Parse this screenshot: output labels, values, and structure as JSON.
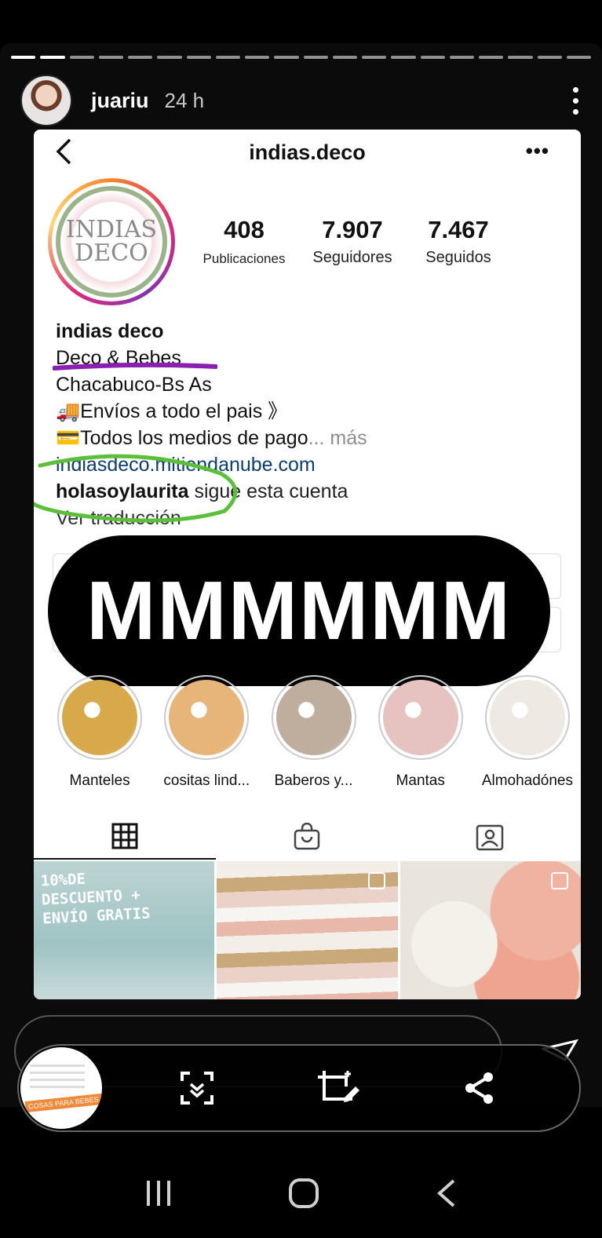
{
  "story": {
    "username": "juariu",
    "time": "24 h",
    "progress_segments": 20,
    "progress_done": 2
  },
  "profile": {
    "username": "indias.deco",
    "logo_text": "INDIAS DECO",
    "stats": [
      {
        "value": "408",
        "label": "Publicaciones"
      },
      {
        "value": "7.907",
        "label": "Seguidores"
      },
      {
        "value": "7.467",
        "label": "Seguidos"
      }
    ],
    "bio": {
      "name": "indias deco",
      "line1": "Deco & Bebes",
      "line2": "Chacabuco-Bs As",
      "line3": "🚚Envíos a todo el pais 》",
      "line4": "💳Todos los medios de pago",
      "more": "... más",
      "link": "indiasdeco.mitiendanube.com",
      "follower": "holasoylaurita",
      "follows_text": " sigue esta cuenta",
      "translate": "Ver traducción"
    },
    "overlay_text": "MMMMMM",
    "highlights": [
      {
        "label": "Manteles",
        "color": "#d7a94a"
      },
      {
        "label": "cositas lind...",
        "color": "#e7b57a"
      },
      {
        "label": "Baberos y...",
        "color": "#bfae9e"
      },
      {
        "label": "Mantas",
        "color": "#e6c3c0"
      },
      {
        "label": "Almohadónes",
        "color": "#eee9e2"
      }
    ],
    "promo_post": {
      "line1": "10%DE",
      "line2": "DESCUENTO +",
      "line3": "ENVÍO GRATIS"
    }
  },
  "thumb_tag": "COSAS PARA BEBES"
}
